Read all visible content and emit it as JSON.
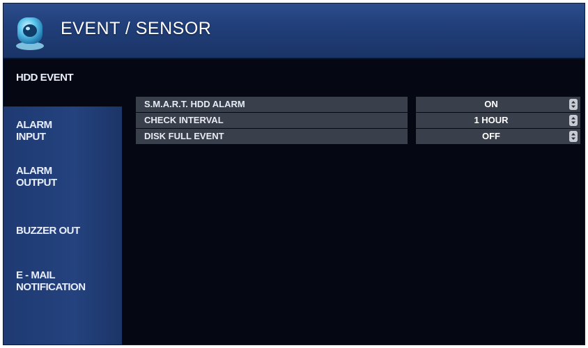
{
  "header": {
    "title": "EVENT / SENSOR",
    "logo_icon": "camera-icon"
  },
  "sidebar": {
    "tabs": [
      {
        "label": "HDD EVENT",
        "active": true
      },
      {
        "label": "ALARM\nINPUT",
        "active": false
      },
      {
        "label": "ALARM\nOUTPUT",
        "active": false
      },
      {
        "label": "BUZZER OUT",
        "active": false
      },
      {
        "label": "E - MAIL\nNOTIFICATION",
        "active": false
      }
    ]
  },
  "settings": {
    "rows": [
      {
        "label": "S.M.A.R.T. HDD ALARM",
        "value": "ON",
        "control_icon": "up-down-spinner-icon"
      },
      {
        "label": "CHECK INTERVAL",
        "value": "1 HOUR",
        "control_icon": "up-down-spinner-icon"
      },
      {
        "label": "DISK FULL EVENT",
        "value": "OFF",
        "control_icon": "up-down-spinner-icon"
      }
    ]
  },
  "colors": {
    "header_blue": "#213f7a",
    "sidebar_blue": "#24427e",
    "background": "#050812",
    "row_gray": "#3a3f4c",
    "text": "#ffffff"
  }
}
